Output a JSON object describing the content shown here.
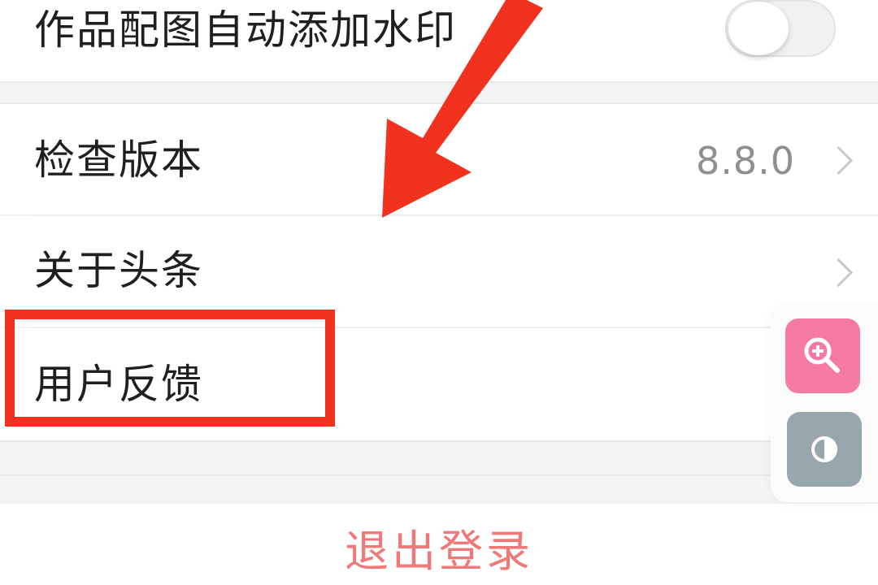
{
  "settings": {
    "watermark": {
      "label": "作品配图自动添加水印",
      "enabled": false
    },
    "check_version": {
      "label": "检查版本",
      "value": "8.8.0"
    },
    "about": {
      "label": "关于头条"
    },
    "feedback": {
      "label": "用户反馈"
    }
  },
  "logout": {
    "label": "退出登录"
  },
  "floating_tools": {
    "zoom_icon": "zoom-in-icon",
    "contrast_icon": "contrast-icon"
  },
  "colors": {
    "annotation": "#f0321f",
    "logout_text": "#f07878",
    "zoom_button": "#f47aa5",
    "contrast_button": "#98a6ad"
  }
}
